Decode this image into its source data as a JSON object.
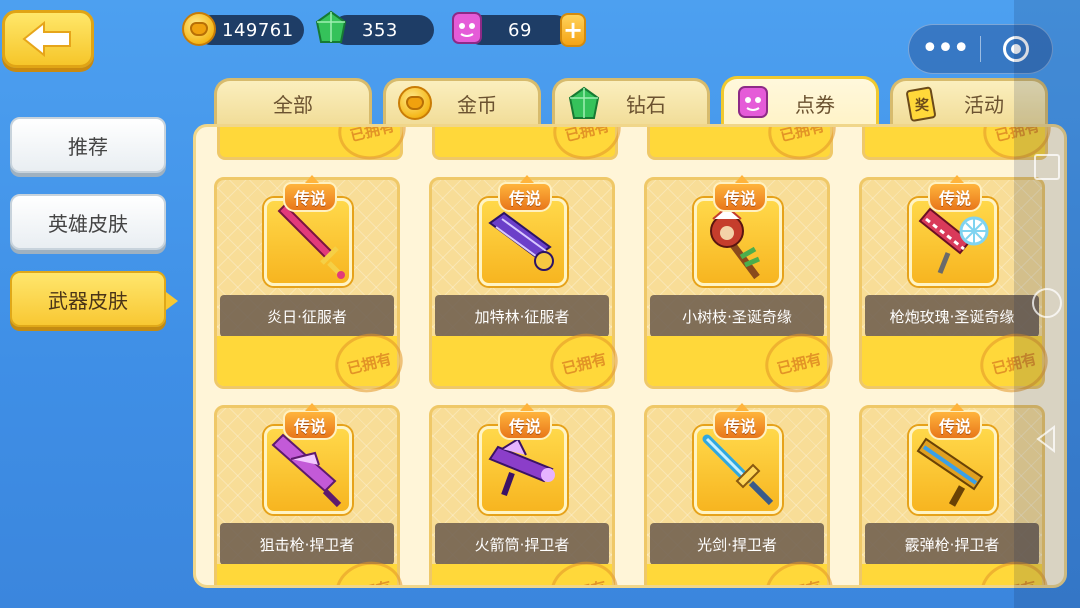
{
  "currency": {
    "coins": "149761",
    "gems": "353",
    "vouchers": "69"
  },
  "tabs": [
    {
      "label": "全部",
      "icon": "none"
    },
    {
      "label": "金币",
      "icon": "coin-icon"
    },
    {
      "label": "钻石",
      "icon": "gem-icon"
    },
    {
      "label": "点券",
      "icon": "voucher-icon"
    },
    {
      "label": "活动",
      "icon": "event-ticket-icon",
      "icon_text": "奖"
    }
  ],
  "active_tab": "点券",
  "sidebar": {
    "items": [
      {
        "label": "推荐"
      },
      {
        "label": "英雄皮肤"
      },
      {
        "label": "武器皮肤"
      }
    ],
    "active": "武器皮肤"
  },
  "badge_text": "传说",
  "owned_text": "已拥有",
  "items": [
    {
      "name": "炎日·征服者",
      "color": "#e23a7a",
      "accent": "#f5d046"
    },
    {
      "name": "加特林·征服者",
      "color": "#6b3fc9",
      "accent": "#d9c8ff"
    },
    {
      "name": "小树枝·圣诞奇缘",
      "color": "#c53d2c",
      "accent": "#4cae4c"
    },
    {
      "name": "枪炮玫瑰·圣诞奇缘",
      "color": "#d93a5a",
      "accent": "#7fd3f0"
    },
    {
      "name": "狙击枪·捍卫者",
      "color": "#c35ad8",
      "accent": "#f3c8ff"
    },
    {
      "name": "火箭筒·捍卫者",
      "color": "#8b3ec9",
      "accent": "#e6b3ff"
    },
    {
      "name": "光剑·捍卫者",
      "color": "#2fa8e0",
      "accent": "#ffd75a"
    },
    {
      "name": "霰弹枪·捍卫者",
      "color": "#e0a020",
      "accent": "#3aa0e8"
    }
  ]
}
